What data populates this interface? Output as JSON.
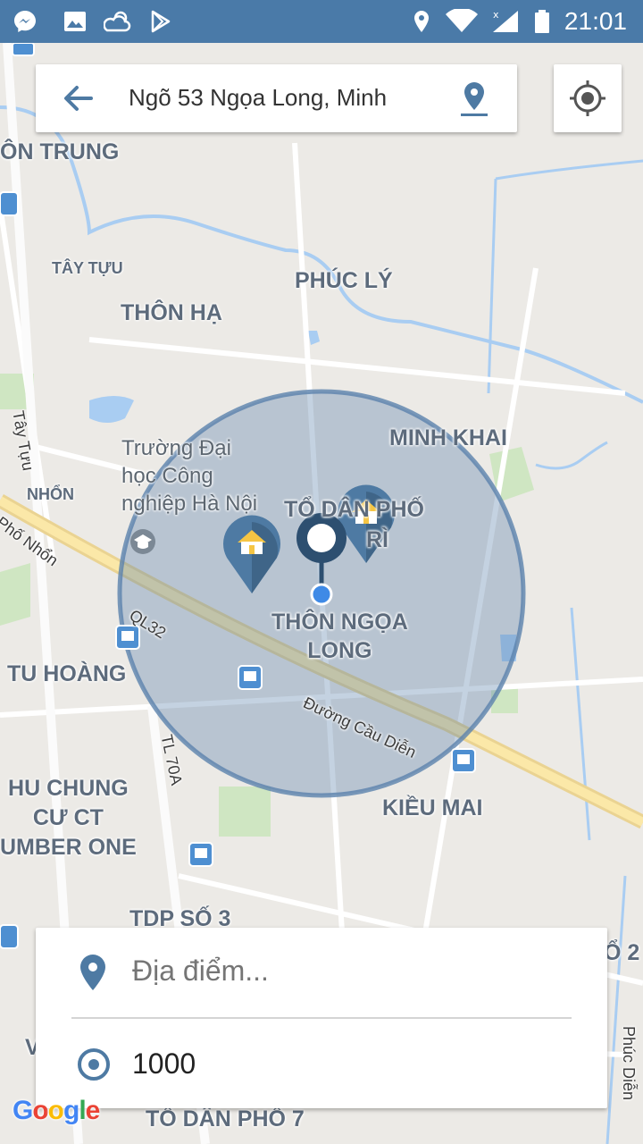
{
  "status_bar": {
    "time": "21:01",
    "icons": [
      "messenger-icon",
      "image-icon",
      "weather-icon",
      "play-store-icon",
      "location-icon",
      "wifi-icon",
      "signal-icon",
      "battery-icon"
    ]
  },
  "search": {
    "text": "Ngõ 53 Ngọa Long, Minh"
  },
  "map": {
    "places": {
      "thon_trung": "ÔN TRUNG",
      "tay_tuu": "TÂY TỰU",
      "phuc_ly": "PHÚC LÝ",
      "thon_ha": "THÔN HẠ",
      "tay_tuu_road": "Tây Tựu",
      "minh_khai": "MINH KHAI",
      "truong_dh": "Trường Đại\nhọc Công\nnghiệp Hà Nội",
      "nhon": "NHỔN",
      "pho_nhon": "Phố Nhổn",
      "to_dan_pho": "TỔ DÂN PHỐ",
      "ri": "RÌ",
      "thon_ngoa_long": "THÔN NGỌA\nLONG",
      "ql32": "QL32",
      "tu_hoang": "TU HOÀNG",
      "duong_cau_dien": "Đường Cầu Diễn",
      "tl70a": "TL 70A",
      "hu_chung": "HU CHUNG\nCƯ CT\nUMBER ONE",
      "kieu_mai": "KIỀU MAI",
      "tdp_so_3": "TDP SỐ 3",
      "o2": "Ổ 2",
      "phuc_dien": "Phúc Diễn",
      "to_dan_pho_7": "TỔ DÂN PHỐ 7",
      "v": "V"
    },
    "radius_circle_color": "#5b82ad",
    "marker_color": "#4e7aa3"
  },
  "bottom_panel": {
    "place_placeholder": "Địa điểm...",
    "radius": "1000"
  },
  "google_logo": "Google"
}
